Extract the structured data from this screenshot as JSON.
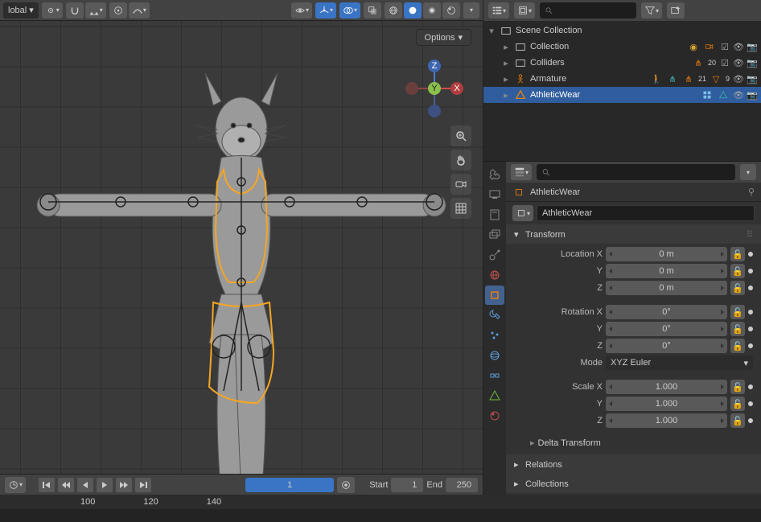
{
  "viewport_header": {
    "orientation_label": "lobal",
    "options_label": "Options"
  },
  "gizmo_axes": {
    "x": "X",
    "y": "Y",
    "z": "Z"
  },
  "timeline": {
    "current_frame": "1",
    "start_label": "Start",
    "start_value": "1",
    "end_label": "End",
    "end_value": "250",
    "ticks": [
      "100",
      "120",
      "140"
    ]
  },
  "outliner": {
    "search_placeholder": "",
    "root": "Scene Collection",
    "items": [
      {
        "label": "Collection",
        "depth": 1,
        "icon": "box",
        "extras": [
          "bulb",
          "camera"
        ],
        "vis": [
          "check",
          "eye",
          "cam"
        ]
      },
      {
        "label": "Colliders",
        "depth": 1,
        "icon": "box",
        "extras": [
          "bone"
        ],
        "count": "20",
        "vis": [
          "check",
          "eye",
          "cam"
        ]
      },
      {
        "label": "Armature",
        "depth": 1,
        "icon": "arm",
        "extras": [
          "man",
          "arm2",
          "bone"
        ],
        "count": "21",
        "bone_count": "9",
        "vis": [
          "eye",
          "cam"
        ]
      },
      {
        "label": "AthleticWear",
        "depth": 1,
        "icon": "mesh",
        "selected": true,
        "extras": [
          "mod",
          "vgroup"
        ],
        "vis": [
          "eye",
          "cam"
        ]
      }
    ]
  },
  "properties": {
    "search_placeholder": "",
    "object_name": "AthleticWear",
    "datablock_name": "AthleticWear",
    "transform": {
      "header": "Transform",
      "location_x_label": "Location X",
      "location_x": "0 m",
      "location_y_label": "Y",
      "location_y": "0 m",
      "location_z_label": "Z",
      "location_z": "0 m",
      "rotation_x_label": "Rotation X",
      "rotation_x": "0°",
      "rotation_y_label": "Y",
      "rotation_y": "0°",
      "rotation_z_label": "Z",
      "rotation_z": "0°",
      "mode_label": "Mode",
      "mode_value": "XYZ Euler",
      "scale_x_label": "Scale X",
      "scale_x": "1.000",
      "scale_y_label": "Y",
      "scale_y": "1.000",
      "scale_z_label": "Z",
      "scale_z": "1.000"
    },
    "delta_transform_label": "Delta Transform",
    "relations_label": "Relations",
    "collections_label": "Collections"
  }
}
